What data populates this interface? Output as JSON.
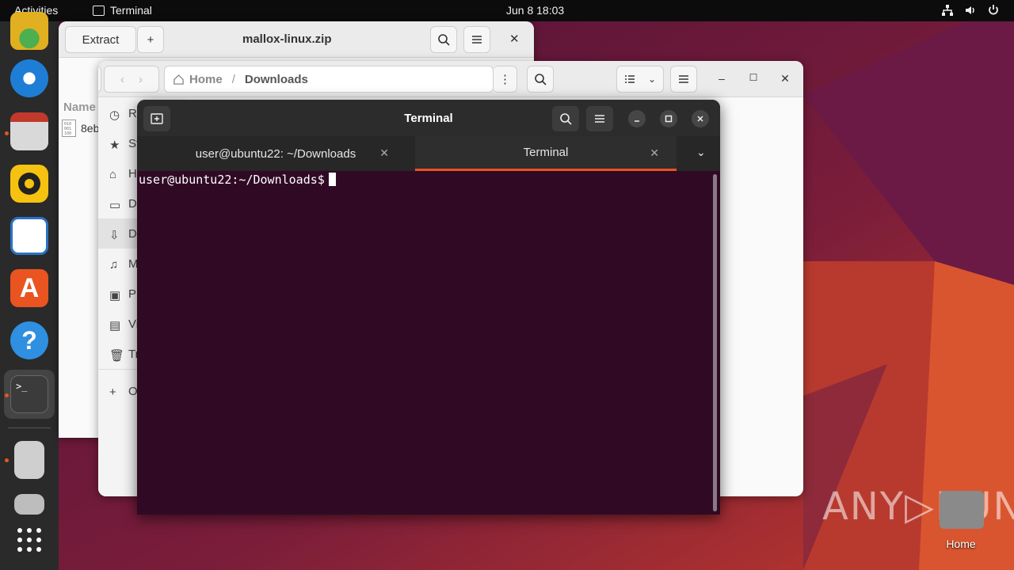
{
  "topbar": {
    "activities": "Activities",
    "app_name": "Terminal",
    "clock": "Jun 8  18:03"
  },
  "dock": {
    "items": [
      {
        "name": "chrome",
        "color": "#e0b020"
      },
      {
        "name": "thunderbird",
        "color": "#1e7ed6"
      },
      {
        "name": "files",
        "color": "#c7c7c7"
      },
      {
        "name": "rhythmbox",
        "color": "#f5c211"
      },
      {
        "name": "libreoffice-writer",
        "color": "#2a72c3"
      },
      {
        "name": "app-center",
        "color": "#e95420"
      },
      {
        "name": "help",
        "color": "#2f8fe0"
      },
      {
        "name": "terminal",
        "color": "#3b3b3b"
      },
      {
        "name": "archive-manager",
        "color": "#cfcfcf"
      },
      {
        "name": "disk",
        "color": "#cfcfcf"
      },
      {
        "name": "show-apps",
        "color": "#ffffff"
      }
    ]
  },
  "archive_window": {
    "extract_label": "Extract",
    "add_label": "+",
    "title": "mallox-linux.zip",
    "column_name": "Name",
    "file_name": "8eb"
  },
  "files_window": {
    "path_home": "Home",
    "path_current": "Downloads",
    "sidebar": [
      "R",
      "St",
      "H",
      "D",
      "D",
      "M",
      "Pi",
      "Vi",
      "Tr",
      "O"
    ]
  },
  "terminal": {
    "title": "Terminal",
    "tabs": [
      {
        "label": "user@ubuntu22: ~/Downloads",
        "active": false
      },
      {
        "label": "Terminal",
        "active": true
      }
    ],
    "prompt": "user@ubuntu22:~/Downloads$"
  },
  "desktop": {
    "home_label": "Home",
    "watermark": "ANY▷RUN"
  },
  "colors": {
    "accent": "#e95420",
    "terminal_bg": "#300a24"
  }
}
